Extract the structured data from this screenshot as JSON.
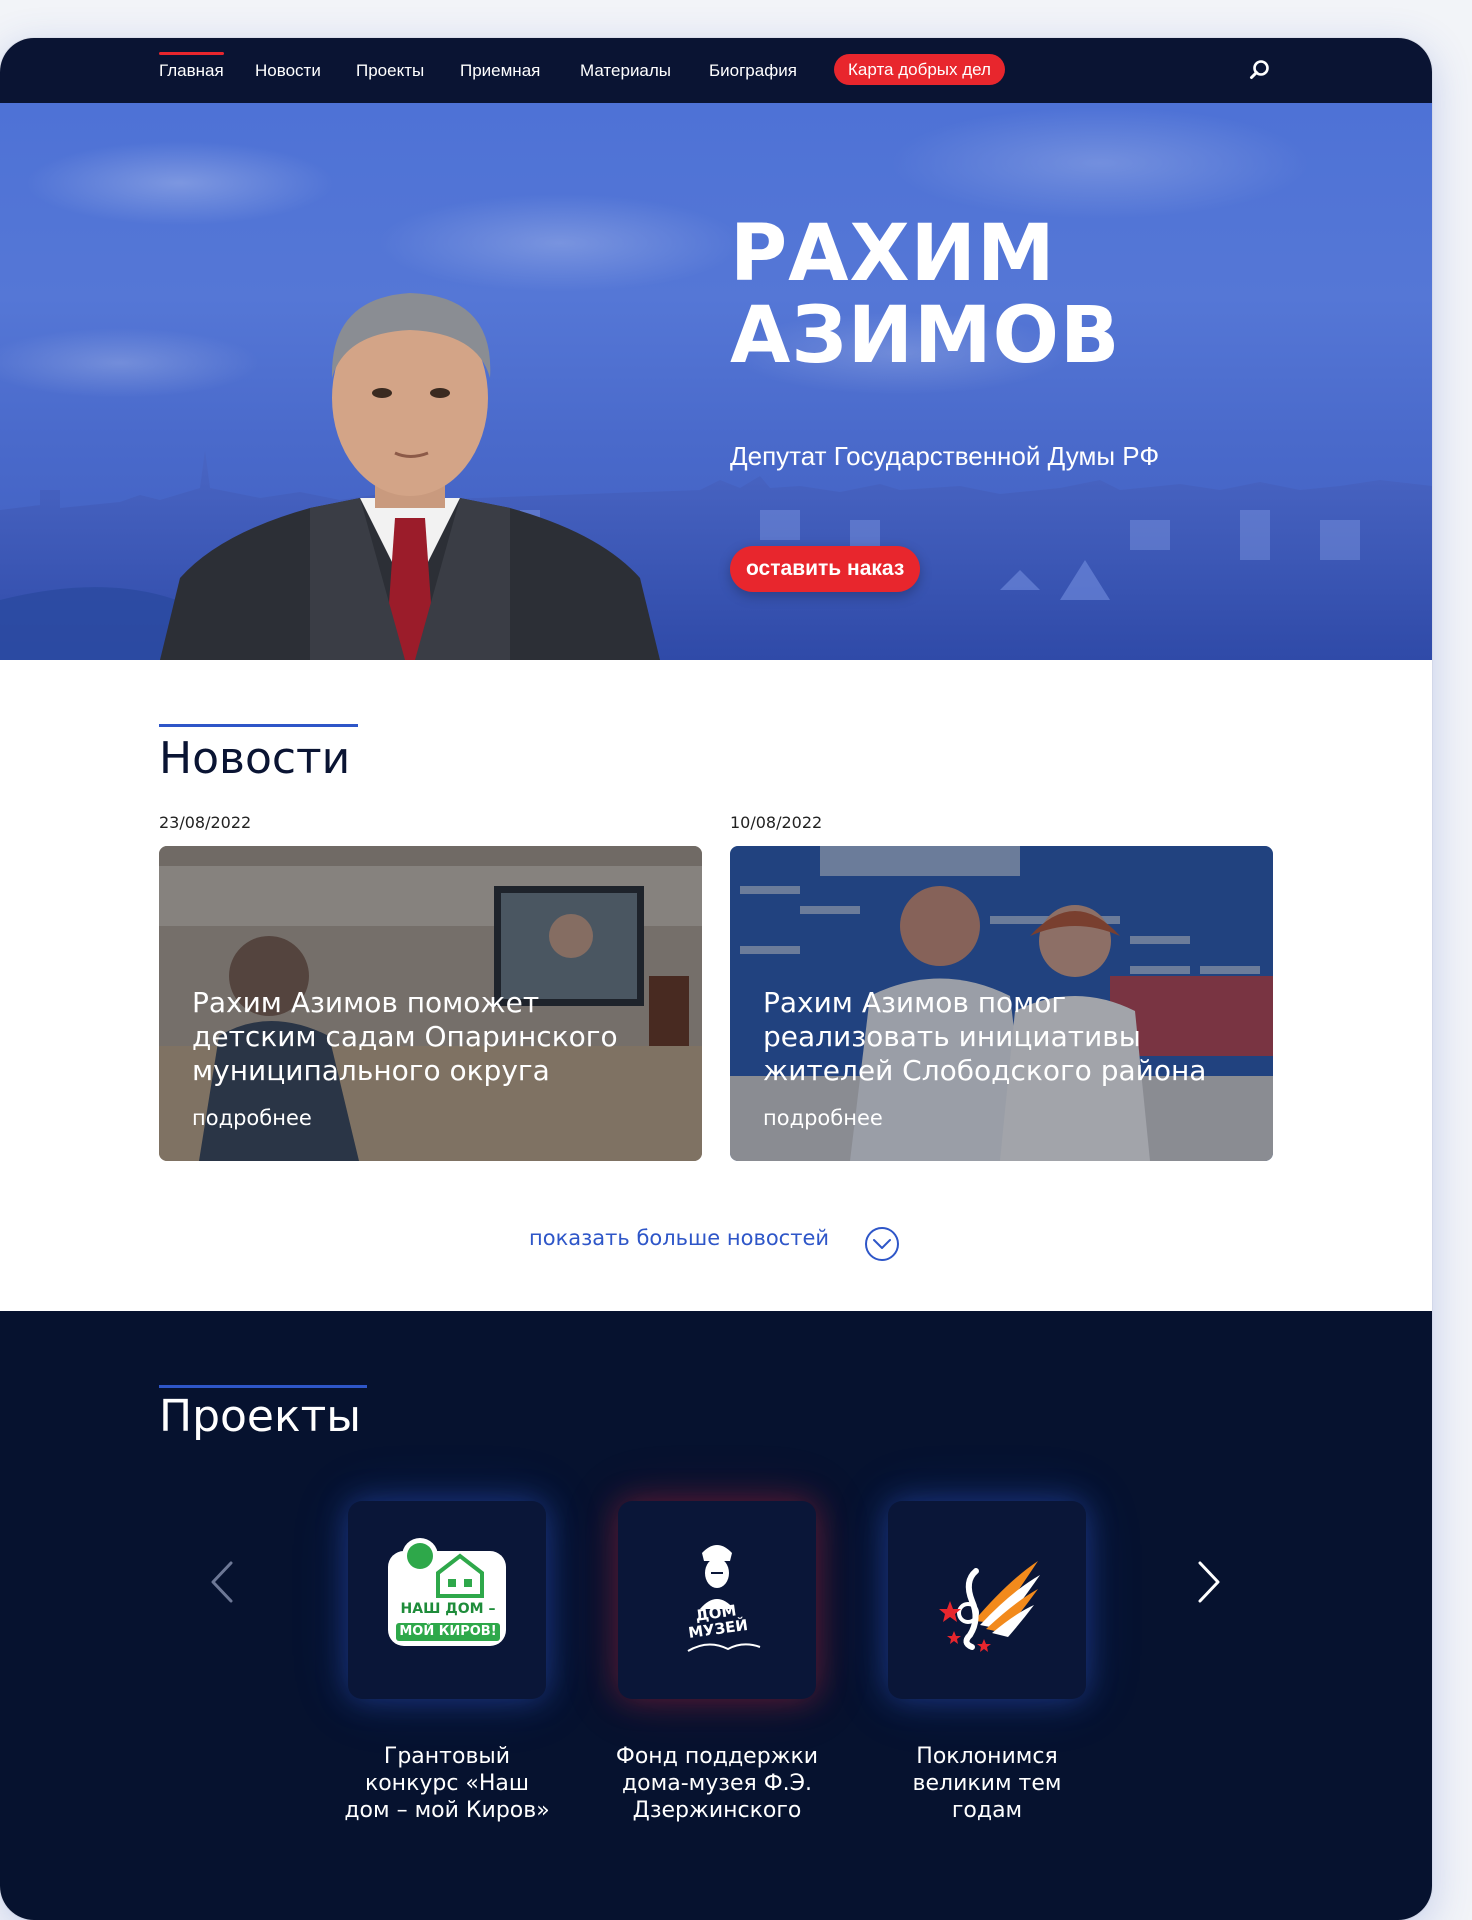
{
  "nav": {
    "items": [
      {
        "label": "Главная",
        "active": true
      },
      {
        "label": "Новости"
      },
      {
        "label": "Проекты"
      },
      {
        "label": "Приемная"
      },
      {
        "label": "Материалы"
      },
      {
        "label": "Биография"
      }
    ],
    "highlight_label": "Карта добрых дел",
    "search_icon": "search-icon"
  },
  "hero": {
    "name_line1": "РАХИМ",
    "name_line2": "АЗИМОВ",
    "subtitle": "Депутат Государственной Думы РФ",
    "button_label": "оставить наказ"
  },
  "news": {
    "heading": "Новости",
    "items": [
      {
        "date": "23/08/2022",
        "title": "Рахим Азимов поможет детским садам Опаринского муниципального округа",
        "more": "подробнее"
      },
      {
        "date": "10/08/2022",
        "title": "Рахим Азимов помог реализовать инициативы жителей Слободского района",
        "more": "подробнее"
      }
    ],
    "show_more": "показать больше новостей",
    "show_more_icon": "chevron-down-circle-icon"
  },
  "projects": {
    "heading": "Проекты",
    "prev_icon": "chevron-left-icon",
    "next_icon": "chevron-right-icon",
    "items": [
      {
        "label": "Грантовый конкурс «Наш дом – мой Киров»",
        "logo_text_1": "НАШ ДОМ –",
        "logo_text_2": "МОЙ КИРОВ!"
      },
      {
        "label": "Фонд поддержки дома-музея Ф.Э. Дзержинского",
        "logo_text_1": "ДОМ",
        "logo_text_2": "МУЗЕЙ"
      },
      {
        "label": "Поклонимся великим тем годам"
      }
    ]
  },
  "colors": {
    "nav_bg": "#0a1433",
    "accent_red": "#e8262d",
    "accent_blue": "#2e56c8",
    "projects_bg": "#06122f"
  }
}
